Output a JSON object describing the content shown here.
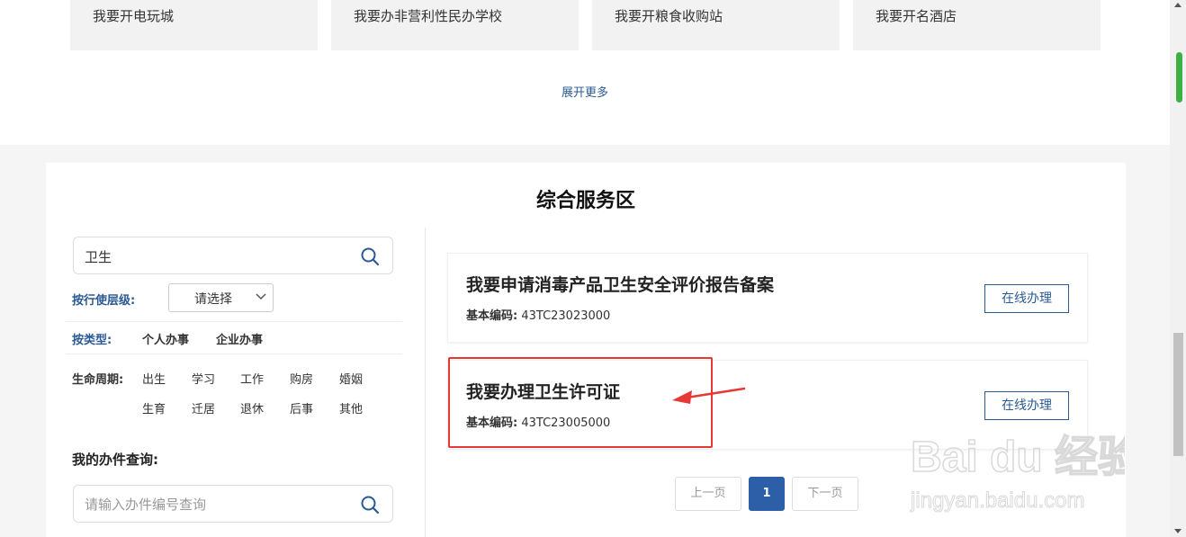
{
  "scenarios": [
    {
      "label": "我要开电玩城"
    },
    {
      "label": "我要办非营利性民办学校"
    },
    {
      "label": "我要开粮食收购站"
    },
    {
      "label": "我要开名酒店"
    }
  ],
  "expand_more": "展开更多",
  "section_title": "综合服务区",
  "search": {
    "value": "卫生"
  },
  "filters": {
    "level_label": "按行使层级:",
    "level_select": "请选择",
    "type_label": "按类型:",
    "types": [
      "个人办事",
      "企业办事"
    ],
    "life_label": "生命周期:",
    "life_row1": [
      "出生",
      "学习",
      "工作",
      "购房",
      "婚姻"
    ],
    "life_row2": [
      "生育",
      "迁居",
      "退休",
      "后事",
      "其他"
    ]
  },
  "query": {
    "title": "我的办件查询:",
    "placeholder": "请输入办件编号查询"
  },
  "results": [
    {
      "title": "我要申请消毒产品卫生安全评价报告备案",
      "code_label": "基本编码:",
      "code": "43TC23023000",
      "button": "在线办理"
    },
    {
      "title": "我要办理卫生许可证",
      "code_label": "基本编码:",
      "code": "43TC23005000",
      "button": "在线办理"
    }
  ],
  "pagination": {
    "prev": "上一页",
    "current": "1",
    "next": "下一页"
  },
  "watermark": {
    "brand": "Bai du 经验",
    "url": "jingyan.baidu.com"
  },
  "colors": {
    "accent": "#2a5a94",
    "highlight": "#e53935",
    "page_current": "#2d5ea8"
  }
}
